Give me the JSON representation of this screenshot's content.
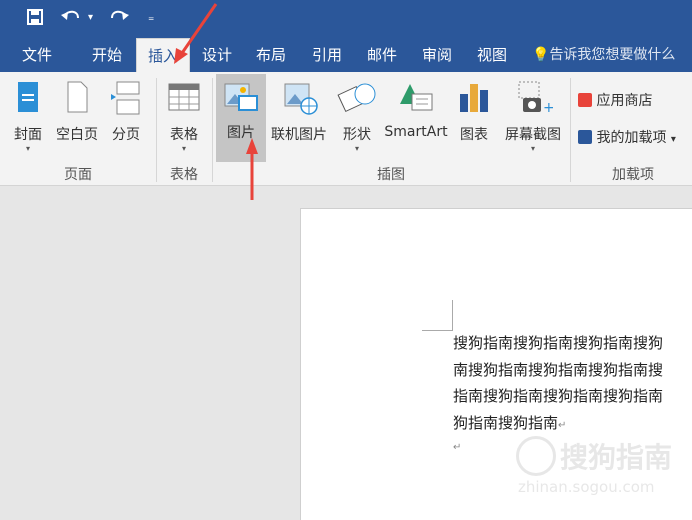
{
  "qat": {
    "save_icon": "save-icon",
    "undo_icon": "undo-icon",
    "redo_icon": "redo-icon",
    "customize_icon": "customize-icon"
  },
  "tabs": [
    {
      "label": "文件"
    },
    {
      "label": "开始"
    },
    {
      "label": "插入"
    },
    {
      "label": "设计"
    },
    {
      "label": "布局"
    },
    {
      "label": "引用"
    },
    {
      "label": "邮件"
    },
    {
      "label": "审阅"
    },
    {
      "label": "视图"
    }
  ],
  "tell_me": {
    "label": "告诉我您想要做什么"
  },
  "ribbon": {
    "pages_group": {
      "label": "页面",
      "cover": "封面",
      "blank": "空白页",
      "break": "分页"
    },
    "table_group": {
      "label": "表格",
      "table": "表格"
    },
    "illustrations_group": {
      "label": "插图",
      "picture": "图片",
      "online_picture": "联机图片",
      "shapes": "形状",
      "smartart": "SmartArt",
      "chart": "图表",
      "screenshot": "屏幕截图"
    },
    "addins_group": {
      "label": "加载项",
      "store": "应用商店",
      "my_addins": "我的加载项"
    }
  },
  "document": {
    "lines": [
      "搜狗指南搜狗指南搜狗指南搜狗",
      "南搜狗指南搜狗指南搜狗指南搜",
      "指南搜狗指南搜狗指南搜狗指南",
      "狗指南搜狗指南"
    ],
    "paragraph_mark": "↵"
  },
  "watermark": {
    "brand": "搜狗指南",
    "url": "zhinan.sogou.com"
  },
  "colors": {
    "accent": "#2b579a",
    "annotation": "#e8433a"
  }
}
